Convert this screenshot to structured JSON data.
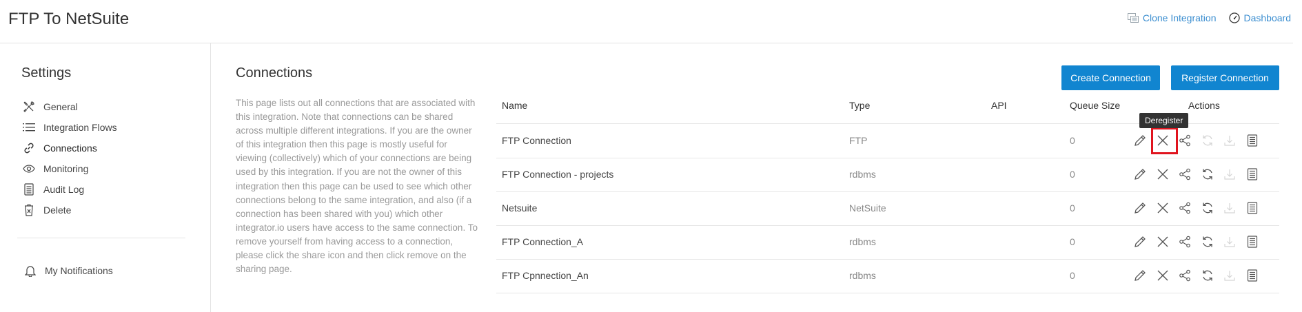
{
  "header": {
    "title": "FTP To NetSuite",
    "clone_label": "Clone Integration",
    "dashboard_label": "Dashboard"
  },
  "sidebar": {
    "title": "Settings",
    "items": [
      {
        "label": "General",
        "icon": "tools-icon"
      },
      {
        "label": "Integration Flows",
        "icon": "list-icon"
      },
      {
        "label": "Connections",
        "icon": "link-icon"
      },
      {
        "label": "Monitoring",
        "icon": "eye-icon"
      },
      {
        "label": "Audit Log",
        "icon": "document-icon"
      },
      {
        "label": "Delete",
        "icon": "trash-icon"
      }
    ],
    "notifications_label": "My Notifications"
  },
  "main": {
    "title": "Connections",
    "description": "This page lists out all connections that are associated with this integration. Note that connections can be shared across multiple different integrations. If you are the owner of this integration then this page is mostly useful for viewing (collectively) which of your connections are being used by this integration. If you are not the owner of this integration then this page can be used to see which other connections belong to the same integration, and also (if a connection has been shared with you) which other integrator.io users have access to the same connection. To remove yourself from having access to a connection, please click the share icon and then click remove on the sharing page.",
    "create_button": "Create Connection",
    "register_button": "Register Connection"
  },
  "table": {
    "columns": [
      "Name",
      "Type",
      "API",
      "Queue Size",
      "Actions"
    ],
    "rows": [
      {
        "name": "FTP Connection",
        "type": "FTP",
        "api": "",
        "queue": "0"
      },
      {
        "name": "FTP Connection - projects",
        "type": "rdbms",
        "api": "",
        "queue": "0"
      },
      {
        "name": "Netsuite",
        "type": "NetSuite",
        "api": "",
        "queue": "0"
      },
      {
        "name": "FTP Connection_A",
        "type": "rdbms",
        "api": "",
        "queue": "0"
      },
      {
        "name": "FTP Cpnnection_An",
        "type": "rdbms",
        "api": "",
        "queue": "0"
      }
    ],
    "tooltip": "Deregister"
  },
  "colors": {
    "accent": "#1185d0",
    "link": "#3b8ed0",
    "highlight": "#e0141e"
  }
}
